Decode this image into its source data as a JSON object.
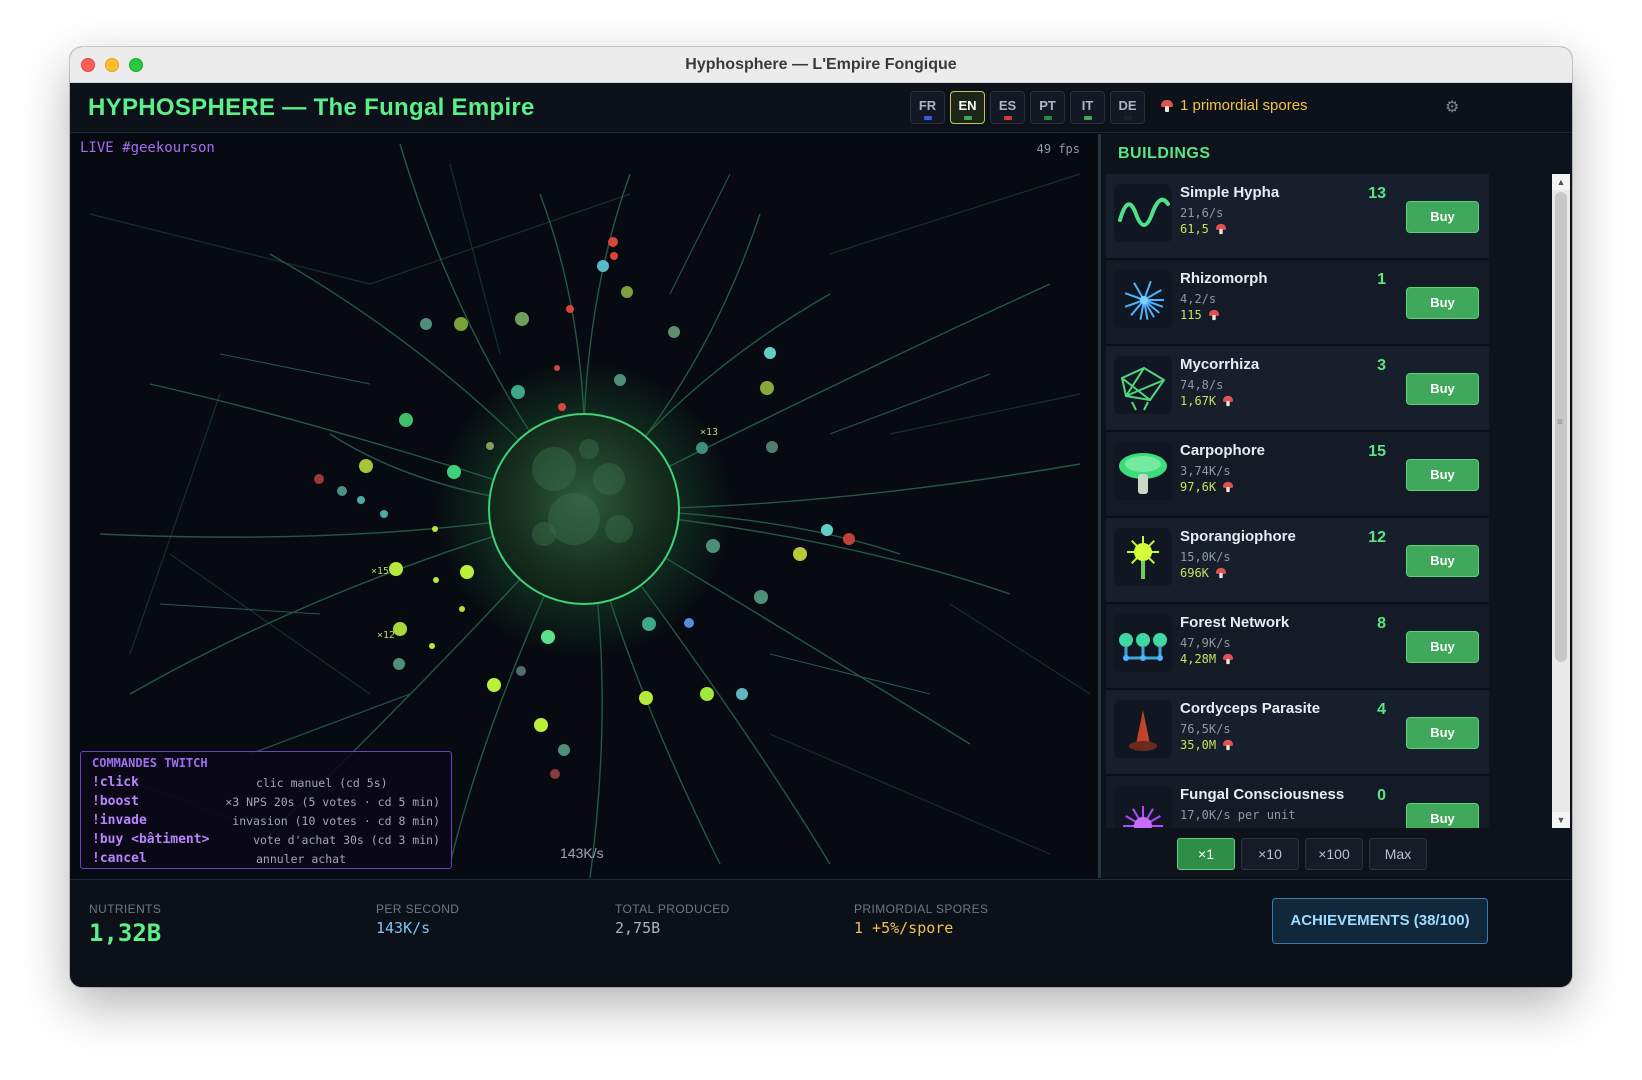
{
  "window": {
    "title": "Hyphosphere — L'Empire Fongique"
  },
  "header": {
    "title": "HYPHOSPHERE — The Fungal Empire",
    "languages": [
      {
        "code": "FR",
        "active": false,
        "flag_color": "#3b5bd9"
      },
      {
        "code": "EN",
        "active": true,
        "flag_color": "#3fa85a"
      },
      {
        "code": "ES",
        "active": false,
        "flag_color": "#d13b3b"
      },
      {
        "code": "PT",
        "active": false,
        "flag_color": "#2d8a45"
      },
      {
        "code": "IT",
        "active": false,
        "flag_color": "#3fa85a"
      },
      {
        "code": "DE",
        "active": false,
        "flag_color": "#222222"
      }
    ],
    "spores_text": "1 primordial spores",
    "settings_icon": "gear-icon"
  },
  "canvas": {
    "live_text": "LIVE #geekourson",
    "fps_text": "49 fps",
    "rate_text": "143K/s",
    "multipliers": [
      "×13",
      "×15",
      "×12"
    ]
  },
  "twitch": {
    "title": "COMMANDES TWITCH",
    "commands": [
      {
        "cmd": "!click",
        "desc": "clic manuel  (cd 5s)"
      },
      {
        "cmd": "!boost",
        "desc": "×3 NPS 20s  (5 votes · cd 5 min)"
      },
      {
        "cmd": "!invade",
        "desc": "invasion  (10 votes · cd 8 min)"
      },
      {
        "cmd": "!buy <bâtiment>",
        "desc": "vote d'achat 30s  (cd 3 min)"
      },
      {
        "cmd": "!cancel",
        "desc": "annuler achat"
      }
    ]
  },
  "buildings": {
    "title": "BUILDINGS",
    "buy_label": "Buy",
    "items": [
      {
        "name": "Simple Hypha",
        "rate": "21,6/s",
        "cost": "61,5",
        "count": "13",
        "icon": "hypha-wave-icon"
      },
      {
        "name": "Rhizomorph",
        "rate": "4,2/s",
        "cost": "115",
        "count": "1",
        "icon": "rhizomorph-burst-icon"
      },
      {
        "name": "Mycorrhiza",
        "rate": "74,8/s",
        "cost": "1,67K",
        "count": "3",
        "icon": "mycorrhiza-net-icon"
      },
      {
        "name": "Carpophore",
        "rate": "3,74K/s",
        "cost": "97,6K",
        "count": "15",
        "icon": "mushroom-cap-icon"
      },
      {
        "name": "Sporangiophore",
        "rate": "15,0K/s",
        "cost": "696K",
        "count": "12",
        "icon": "spore-bulb-icon"
      },
      {
        "name": "Forest Network",
        "rate": "47,9K/s",
        "cost": "4,28M",
        "count": "8",
        "icon": "tree-network-icon"
      },
      {
        "name": "Cordyceps Parasite",
        "rate": "76,5K/s",
        "cost": "35,0M",
        "count": "4",
        "icon": "cordyceps-icon"
      },
      {
        "name": "Fungal Consciousness",
        "rate": "17,0K/s per unit",
        "cost": "",
        "count": "0",
        "icon": "consciousness-burst-icon"
      }
    ],
    "quantities": [
      {
        "label": "×1",
        "active": true
      },
      {
        "label": "×10",
        "active": false
      },
      {
        "label": "×100",
        "active": false
      },
      {
        "label": "Max",
        "active": false
      }
    ]
  },
  "footer": {
    "nutrients_label": "NUTRIENTS",
    "nutrients_value": "1,32B",
    "per_second_label": "PER SECOND",
    "per_second_value": "143K/s",
    "total_label": "TOTAL PRODUCED",
    "total_value": "2,75B",
    "spores_label": "PRIMORDIAL SPORES",
    "spores_value": "1 +5%/spore",
    "achievements_label": "ACHIEVEMENTS (38/100)"
  },
  "colors": {
    "accent_green": "#59e683",
    "spore_yellow": "#f2c24a",
    "twitch_purple": "#a06ef0",
    "buy_green": "#3fa85a"
  }
}
